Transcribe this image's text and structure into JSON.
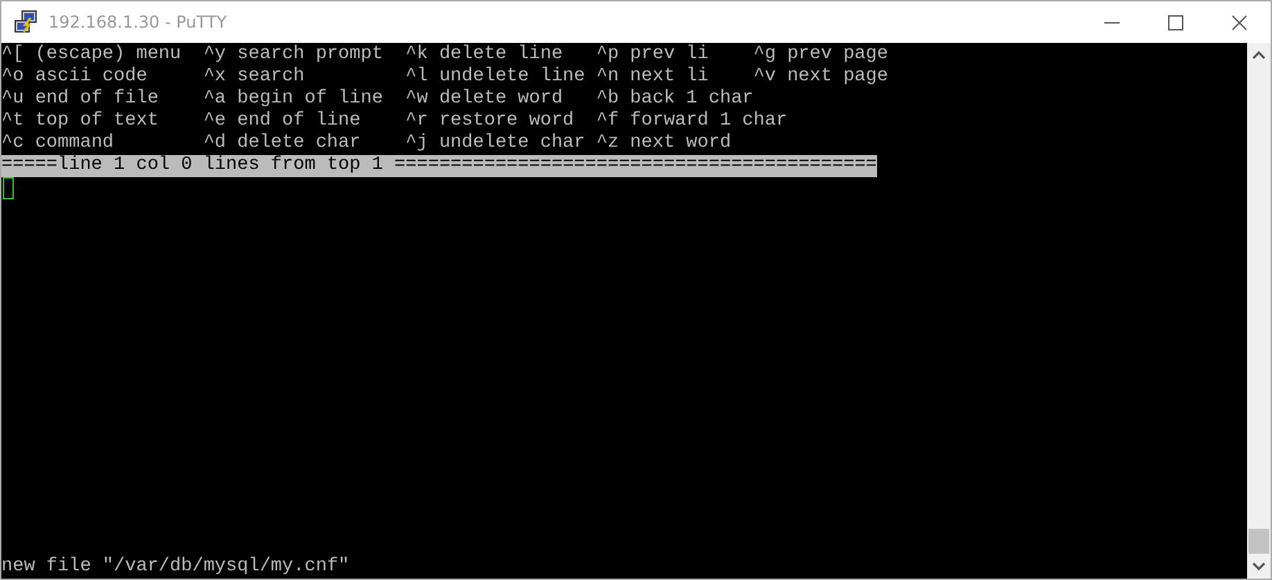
{
  "window": {
    "title": "192.168.1.30 - PuTTY"
  },
  "help_menu": {
    "rows": [
      [
        {
          "key": "^[",
          "action": "(escape) menu"
        },
        {
          "key": "^y",
          "action": "search prompt"
        },
        {
          "key": "^k",
          "action": "delete line"
        },
        {
          "key": "^p",
          "action": "prev li"
        },
        {
          "key": "^g",
          "action": "prev page"
        }
      ],
      [
        {
          "key": "^o",
          "action": "ascii code"
        },
        {
          "key": "^x",
          "action": "search"
        },
        {
          "key": "^l",
          "action": "undelete line"
        },
        {
          "key": "^n",
          "action": "next li"
        },
        {
          "key": "^v",
          "action": "next page"
        }
      ],
      [
        {
          "key": "^u",
          "action": "end of file"
        },
        {
          "key": "^a",
          "action": "begin of line"
        },
        {
          "key": "^w",
          "action": "delete word"
        },
        {
          "key": "^b",
          "action": "back 1 char"
        }
      ],
      [
        {
          "key": "^t",
          "action": "top of text"
        },
        {
          "key": "^e",
          "action": "end of line"
        },
        {
          "key": "^r",
          "action": "restore word"
        },
        {
          "key": "^f",
          "action": "forward 1 char"
        }
      ],
      [
        {
          "key": "^c",
          "action": "command"
        },
        {
          "key": "^d",
          "action": "delete char"
        },
        {
          "key": "^j",
          "action": "undelete char"
        },
        {
          "key": "^z",
          "action": "next word"
        }
      ]
    ]
  },
  "status_line": "=====line 1 col 0 lines from top 1 ===========================================",
  "message_line": "new file \"/var/db/mysql/my.cnf\""
}
